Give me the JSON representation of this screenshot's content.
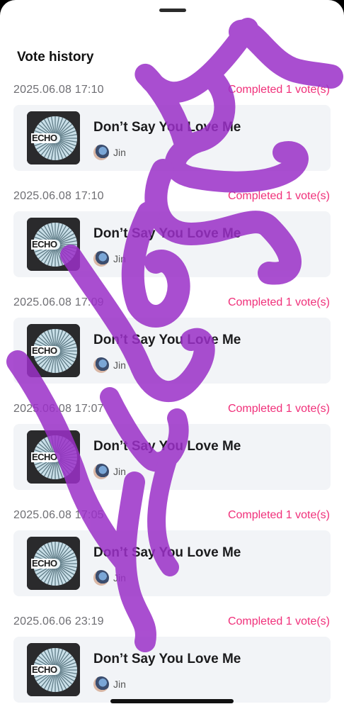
{
  "sheet": {
    "title": "Vote history"
  },
  "accent_color": "#f0307a",
  "entries": [
    {
      "date": "2025.06.08 17:10",
      "status": "Completed 1 vote(s)",
      "song": "Don’t Say You Love Me",
      "artist": "Jin",
      "cover_text": "ECHO"
    },
    {
      "date": "2025.06.08 17:10",
      "status": "Completed 1 vote(s)",
      "song": "Don’t Say You Love Me",
      "artist": "Jin",
      "cover_text": "ECHO"
    },
    {
      "date": "2025.06.08 17:09",
      "status": "Completed 1 vote(s)",
      "song": "Don’t Say You Love Me",
      "artist": "Jin",
      "cover_text": "ECHO"
    },
    {
      "date": "2025.06.08 17:07",
      "status": "Completed 1 vote(s)",
      "song": "Don’t Say You Love Me",
      "artist": "Jin",
      "cover_text": "ECHO"
    },
    {
      "date": "2025.06.08 17:05",
      "status": "Completed 1 vote(s)",
      "song": "Don’t Say You Love Me",
      "artist": "Jin",
      "cover_text": "ECHO"
    },
    {
      "date": "2025.06.06 23:19",
      "status": "Completed 1 vote(s)",
      "song": "Don’t Say You Love Me",
      "artist": "Jin",
      "cover_text": "ECHO"
    }
  ]
}
